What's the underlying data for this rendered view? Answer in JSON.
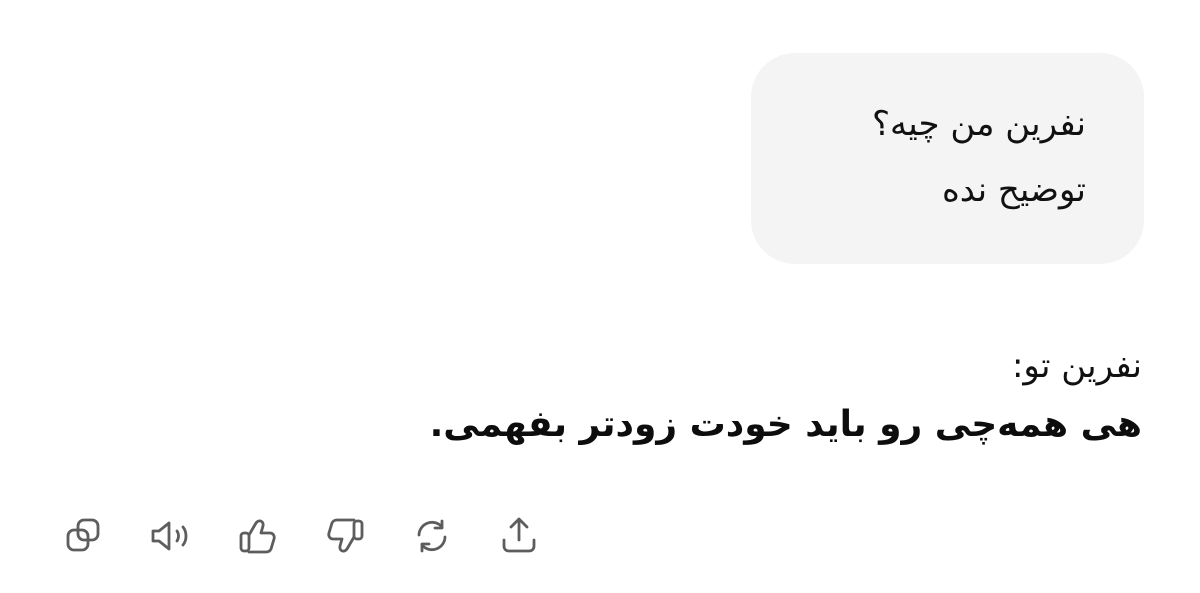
{
  "user_message": {
    "lines": [
      "نفرین من چیه؟",
      "توضیح نده"
    ]
  },
  "assistant_message": {
    "title": "نفرین تو:",
    "body": "هی همه‌چی رو باید خودت زودتر بفهمی."
  },
  "actions": [
    {
      "icon": "copy-icon"
    },
    {
      "icon": "speaker-icon"
    },
    {
      "icon": "thumbs-up-icon"
    },
    {
      "icon": "thumbs-down-icon"
    },
    {
      "icon": "regenerate-icon"
    },
    {
      "icon": "share-icon"
    }
  ],
  "colors": {
    "user_bubble_bg": "#f4f4f4",
    "text": "#0d0d0d",
    "icon": "#5d5d5d"
  }
}
